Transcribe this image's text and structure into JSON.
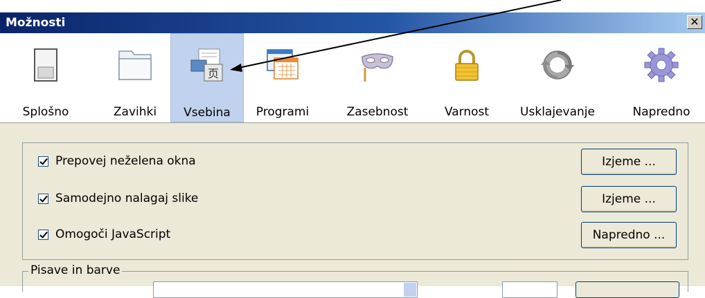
{
  "window": {
    "title": "Možnosti"
  },
  "toolbar": {
    "tabs": [
      {
        "label": "Splošno",
        "icon": "general-icon"
      },
      {
        "label": "Zavihki",
        "icon": "tabs-icon"
      },
      {
        "label": "Vsebina",
        "icon": "content-icon",
        "selected": true
      },
      {
        "label": "Programi",
        "icon": "applications-icon"
      },
      {
        "label": "Zasebnost",
        "icon": "privacy-mask-icon"
      },
      {
        "label": "Varnost",
        "icon": "security-lock-icon"
      },
      {
        "label": "Usklajevanje",
        "icon": "sync-icon"
      },
      {
        "label": "Napredno",
        "icon": "advanced-gear-icon"
      }
    ]
  },
  "content": {
    "options": [
      {
        "label": "Prepovej neželena okna",
        "checked": true,
        "button": "Izjeme ..."
      },
      {
        "label": "Samodejno nalagaj slike",
        "checked": true,
        "button": "Izjeme ..."
      },
      {
        "label": "Omogoči JavaScript",
        "checked": true,
        "button": "Napredno ..."
      }
    ],
    "fonts_group": {
      "legend": "Pisave in barve"
    }
  },
  "colors": {
    "title_bar": "#0a246a",
    "selected_tab": "#c1d2ee",
    "dialog_bg": "#ece9d8"
  }
}
